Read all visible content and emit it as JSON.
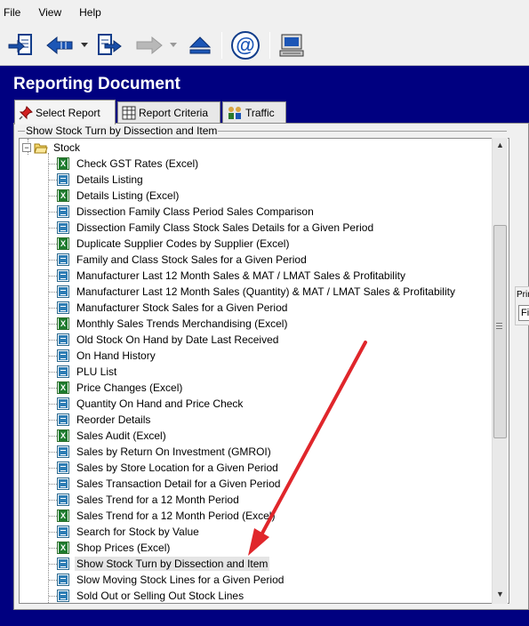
{
  "menu": {
    "file": "File",
    "view": "View",
    "help": "Help"
  },
  "toolbar": {
    "icons": [
      "exit-document-icon",
      "back-arrow-icon",
      "forward-document-icon",
      "forward-arrow-icon",
      "eject-icon",
      "email-icon",
      "computer-icon"
    ]
  },
  "window": {
    "title": "Reporting Document"
  },
  "tabs": [
    {
      "label": "Select Report",
      "icon": "pushpin-icon",
      "active": true
    },
    {
      "label": "Report Criteria",
      "icon": "grid-icon",
      "active": false
    },
    {
      "label": "Traffic",
      "icon": "people-icon",
      "active": false
    }
  ],
  "group": {
    "label": "Show Stock Turn by Dissection and Item"
  },
  "tree": {
    "root": {
      "label": "Stock",
      "expand_symbol": "−"
    },
    "items": [
      {
        "label": "Check GST Rates (Excel)",
        "type": "excel"
      },
      {
        "label": "Details Listing",
        "type": "report"
      },
      {
        "label": "Details Listing (Excel)",
        "type": "excel"
      },
      {
        "label": "Dissection Family Class Period Sales Comparison",
        "type": "report"
      },
      {
        "label": "Dissection Family Class Stock Sales Details for a Given Period",
        "type": "report"
      },
      {
        "label": "Duplicate Supplier Codes by Supplier (Excel)",
        "type": "excel"
      },
      {
        "label": "Family and Class Stock Sales for a Given Period",
        "type": "report"
      },
      {
        "label": "Manufacturer Last 12 Month Sales & MAT / LMAT Sales & Profitability",
        "type": "report"
      },
      {
        "label": "Manufacturer Last 12 Month Sales (Quantity) & MAT / LMAT Sales & Profitability",
        "type": "report"
      },
      {
        "label": "Manufacturer Stock Sales for a Given Period",
        "type": "report"
      },
      {
        "label": "Monthly Sales Trends Merchandising (Excel)",
        "type": "excel"
      },
      {
        "label": "Old Stock On Hand by Date Last Received",
        "type": "report"
      },
      {
        "label": "On Hand History",
        "type": "report"
      },
      {
        "label": "PLU List",
        "type": "report"
      },
      {
        "label": "Price Changes (Excel)",
        "type": "excel"
      },
      {
        "label": "Quantity On Hand and Price Check",
        "type": "report"
      },
      {
        "label": "Reorder Details",
        "type": "report"
      },
      {
        "label": "Sales Audit (Excel)",
        "type": "excel"
      },
      {
        "label": "Sales by Return On Investment (GMROI)",
        "type": "report"
      },
      {
        "label": "Sales by Store Location for a Given Period",
        "type": "report"
      },
      {
        "label": "Sales Transaction Detail for a Given Period",
        "type": "report"
      },
      {
        "label": "Sales Trend for a 12 Month Period",
        "type": "report"
      },
      {
        "label": "Sales Trend for a 12 Month Period (Excel)",
        "type": "excel"
      },
      {
        "label": "Search for Stock by Value",
        "type": "report"
      },
      {
        "label": "Shop Prices (Excel)",
        "type": "excel"
      },
      {
        "label": "Show Stock Turn by Dissection and Item",
        "type": "report",
        "selected": true
      },
      {
        "label": "Slow Moving Stock Lines for a Given Period",
        "type": "report"
      },
      {
        "label": "Sold Out or Selling Out Stock Lines",
        "type": "report"
      }
    ]
  },
  "side_panel": {
    "label": "Prin",
    "field": "Fi"
  },
  "colors": {
    "background": "#000080",
    "annotation_arrow": "#e0262b"
  }
}
